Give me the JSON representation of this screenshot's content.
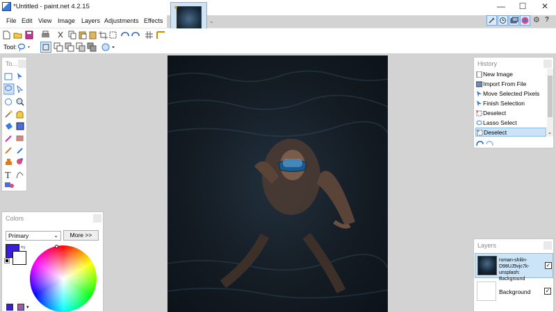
{
  "window": {
    "title": "*Untitled - paint.net 4.2.15",
    "minimize": "—",
    "maximize": "☐",
    "close": "✕"
  },
  "menu": [
    "File",
    "Edit",
    "View",
    "Image",
    "Layers",
    "Adjustments",
    "Effects"
  ],
  "toolbar": {
    "tool_label": "Tool:"
  },
  "tools_panel": {
    "title": "To..."
  },
  "colors_panel": {
    "title": "Colors",
    "selector_value": "Primary",
    "more_button": "More >>"
  },
  "history_panel": {
    "title": "History",
    "items": [
      "New Image",
      "Import From File",
      "Move Selected Pixels",
      "Finish Selection",
      "Deselect",
      "Lasso Select",
      "Deselect"
    ],
    "selected_index": 6
  },
  "layers_panel": {
    "title": "Layers",
    "layers": [
      {
        "name": "roman-shilin-D98UJ5vjc7k-unsplash: Background",
        "checked": true,
        "selected": true
      },
      {
        "name": "Background",
        "checked": true,
        "selected": false
      }
    ]
  },
  "colors": {
    "accent": "#3a7be0",
    "primary_color": "#3a1ee0",
    "selection_bg": "#cce4f7"
  }
}
